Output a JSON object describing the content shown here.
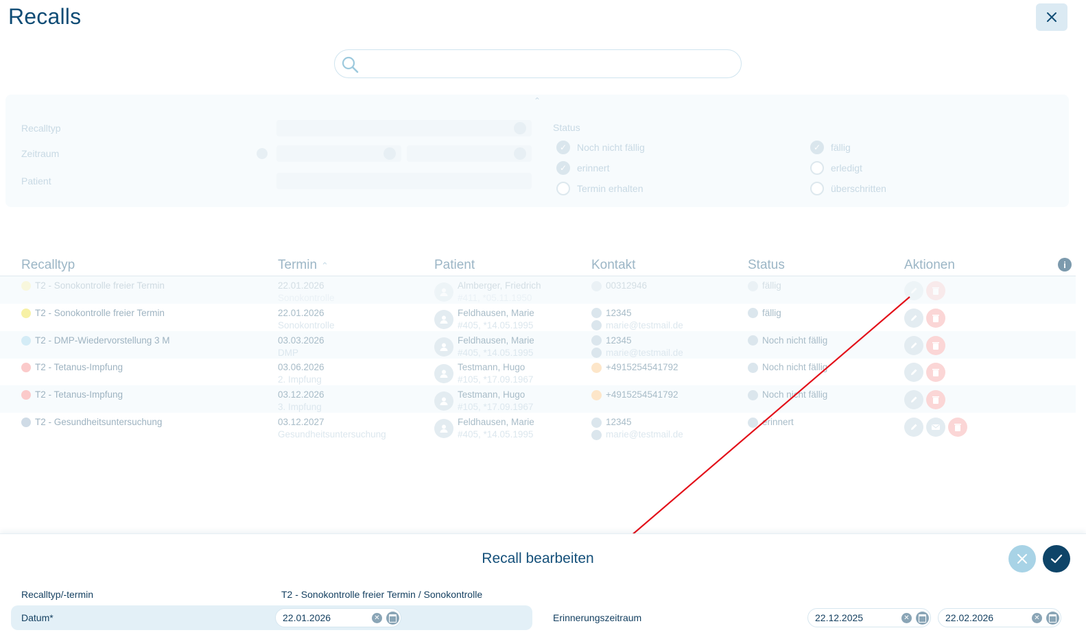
{
  "page": {
    "title": "Recalls"
  },
  "search": {
    "placeholder": ""
  },
  "filters": {
    "recalltyp_label": "Recalltyp",
    "zeitraum_label": "Zeitraum",
    "patient_label": "Patient",
    "status_label": "Status",
    "status_options": [
      {
        "label": "Noch nicht fällig",
        "checked": true
      },
      {
        "label": "fällig",
        "checked": true
      },
      {
        "label": "erinnert",
        "checked": true
      },
      {
        "label": "erledigt",
        "checked": false
      },
      {
        "label": "Termin erhalten",
        "checked": false
      },
      {
        "label": "überschritten",
        "checked": false
      }
    ]
  },
  "table": {
    "columns": [
      "Recalltyp",
      "Termin",
      "Patient",
      "Kontakt",
      "Status",
      "Aktionen"
    ],
    "rows": [
      {
        "type": "T2 - Sonokontrolle freier Termin",
        "color": "#fbf3b8",
        "date": "22.01.2026",
        "sub": "Sonokontrolle",
        "patient": "Almberger, Friedrich",
        "patient_sub": "#411, *05.11.1950",
        "phone": "00312946",
        "email": "",
        "status": "fällig",
        "actions": [
          "edit",
          "delete"
        ]
      },
      {
        "type": "T2 - Sonokontrolle freier Termin",
        "color": "#f7f1a5",
        "date": "22.01.2026",
        "sub": "Sonokontrolle",
        "patient": "Feldhausen, Marie",
        "patient_sub": "#405, *14.05.1995",
        "phone": "12345",
        "email": "marie@testmail.de",
        "status": "fällig",
        "actions": [
          "edit",
          "delete"
        ]
      },
      {
        "type": "T2 - DMP-Wiedervorstellung 3 M",
        "color": "#d4ecf6",
        "date": "03.03.2026",
        "sub": "DMP",
        "patient": "Feldhausen, Marie",
        "patient_sub": "#405, *14.05.1995",
        "phone": "12345",
        "email": "marie@testmail.de",
        "status": "Noch nicht fällig",
        "actions": [
          "edit",
          "delete"
        ]
      },
      {
        "type": "T2 - Tetanus-Impfung",
        "color": "#fbcaca",
        "date": "03.06.2026",
        "sub": "2. Impfung",
        "patient": "Testmann, Hugo",
        "patient_sub": "#105, *17.09.1967",
        "phone": "+4915254541792",
        "email": "",
        "status": "Noch nicht fällig",
        "actions": [
          "edit",
          "delete"
        ]
      },
      {
        "type": "T2 - Tetanus-Impfung",
        "color": "#fbcaca",
        "date": "03.12.2026",
        "sub": "3. Impfung",
        "patient": "Testmann, Hugo",
        "patient_sub": "#105, *17.09.1967",
        "phone": "+4915254541792",
        "email": "",
        "status": "Noch nicht fällig",
        "actions": [
          "edit",
          "delete"
        ]
      },
      {
        "type": "T2 - Gesundheitsuntersuchung",
        "color": "#cfdbe6",
        "date": "03.12.2027",
        "sub": "Gesundheitsuntersuchung",
        "patient": "Feldhausen, Marie",
        "patient_sub": "#405, *14.05.1995",
        "phone": "12345",
        "email": "marie@testmail.de",
        "status": "erinnert",
        "actions": [
          "edit",
          "mail",
          "delete"
        ]
      }
    ]
  },
  "edit_panel": {
    "title": "Recall bearbeiten",
    "recalltyp_label": "Recalltyp/-termin",
    "recalltyp_value": "T2 - Sonokontrolle freier Termin / Sonokontrolle",
    "datum_label": "Datum*",
    "datum_value": "22.01.2026",
    "erinnerung_label": "Erinnerungszeitraum",
    "erinnerung_from": "22.12.2025",
    "erinnerung_to": "22.02.2026"
  },
  "colors": {
    "primary": "#0e4468",
    "accent": "#a8d3e6",
    "arrow": "#e3101a"
  }
}
